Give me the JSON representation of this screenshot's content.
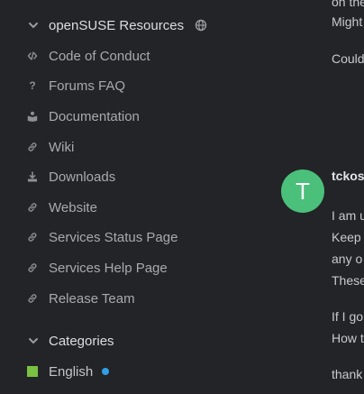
{
  "sidebar": {
    "section_resources": {
      "label": "openSUSE Resources",
      "icon": "chevron-down-icon",
      "extra_icon": "globe-icon",
      "items": [
        {
          "label": "Code of Conduct",
          "icon": "code-icon"
        },
        {
          "label": "Forums FAQ",
          "icon": "question-icon"
        },
        {
          "label": "Documentation",
          "icon": "book-reader-icon"
        },
        {
          "label": "Wiki",
          "icon": "link-icon"
        },
        {
          "label": "Downloads",
          "icon": "download-icon"
        },
        {
          "label": "Website",
          "icon": "link-icon"
        },
        {
          "label": "Services Status Page",
          "icon": "link-icon"
        },
        {
          "label": "Services Help Page",
          "icon": "link-icon"
        },
        {
          "label": "Release Team",
          "icon": "link-icon"
        }
      ]
    },
    "section_categories": {
      "label": "Categories",
      "icon": "chevron-down-icon",
      "items": [
        {
          "label": "English",
          "color": "#7ac143",
          "unread_dot_color": "#2fa0e6"
        }
      ]
    }
  },
  "post": {
    "avatar_letter": "T",
    "avatar_color": "#4bc07a",
    "username": "tckos",
    "lines_top": [
      "on the",
      "Might"
    ],
    "line_could": "Could",
    "body": [
      "I am u",
      "Keep",
      "any o",
      "These"
    ],
    "body2": [
      "If I go",
      "How t"
    ],
    "line_thanks": "thank"
  }
}
